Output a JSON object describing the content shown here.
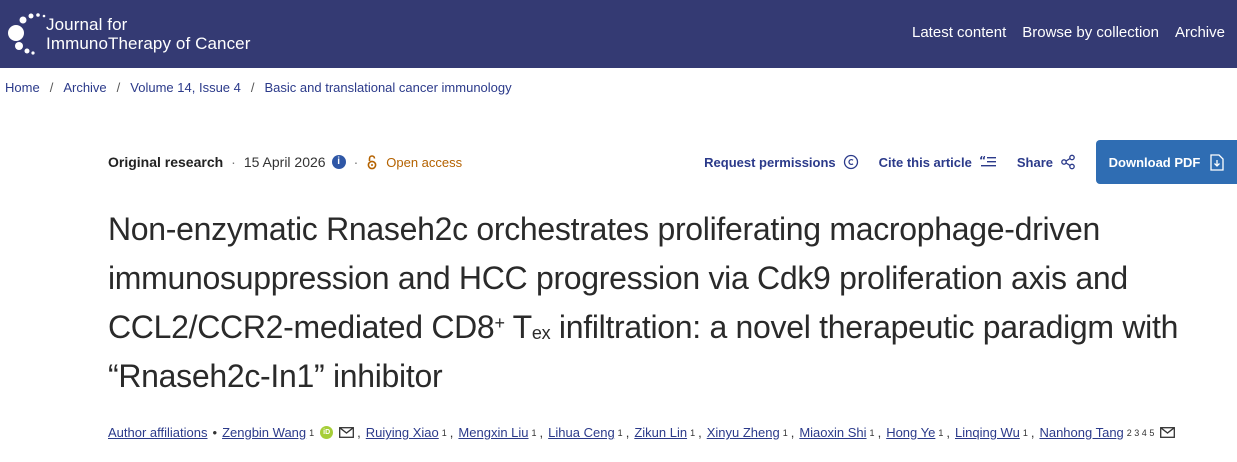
{
  "header": {
    "logo_line1": "Journal for",
    "logo_line2": "ImmunoTherapy of Cancer",
    "nav": [
      "Latest content",
      "Browse by collection",
      "Archive"
    ],
    "bg_color": "#343a73"
  },
  "breadcrumb": [
    "Home",
    "Archive",
    "Volume 14, Issue 4",
    "Basic and translational cancer immunology"
  ],
  "meta": {
    "article_type": "Original research",
    "date": "15 April 2026",
    "info_icon": "i",
    "access": "Open access"
  },
  "actions": {
    "permissions": "Request permissions",
    "cite": "Cite this article",
    "share": "Share",
    "download": "Download PDF"
  },
  "title": {
    "part1": "Non-enzymatic Rnaseh2c orchestrates proliferating macrophage-driven immunosuppression and HCC progression via Cdk9 proliferation axis and CCL2/CCR2-mediated CD8",
    "sup": "+",
    "part2": " T",
    "sub": "ex",
    "part3": " infiltration: a novel therapeutic paradigm with “Rnaseh2c-In1” inhibitor"
  },
  "authors": {
    "affiliations_label": "Author affiliations",
    "orcid_label": "iD",
    "list": [
      {
        "name": "Zengbin Wang",
        "aff": "1"
      },
      {
        "name": "Ruiying Xiao",
        "aff": "1"
      },
      {
        "name": "Mengxin Liu",
        "aff": "1"
      },
      {
        "name": "Lihua Ceng",
        "aff": "1"
      },
      {
        "name": "Zikun Lin",
        "aff": "1"
      },
      {
        "name": "Xinyu Zheng",
        "aff": "1"
      },
      {
        "name": "Miaoxin Shi",
        "aff": "1"
      },
      {
        "name": "Hong Ye",
        "aff": "1"
      },
      {
        "name": "Linqing Wu",
        "aff": "1"
      },
      {
        "name": "Nanhong Tang",
        "aff": "2 3 4 5"
      }
    ]
  }
}
